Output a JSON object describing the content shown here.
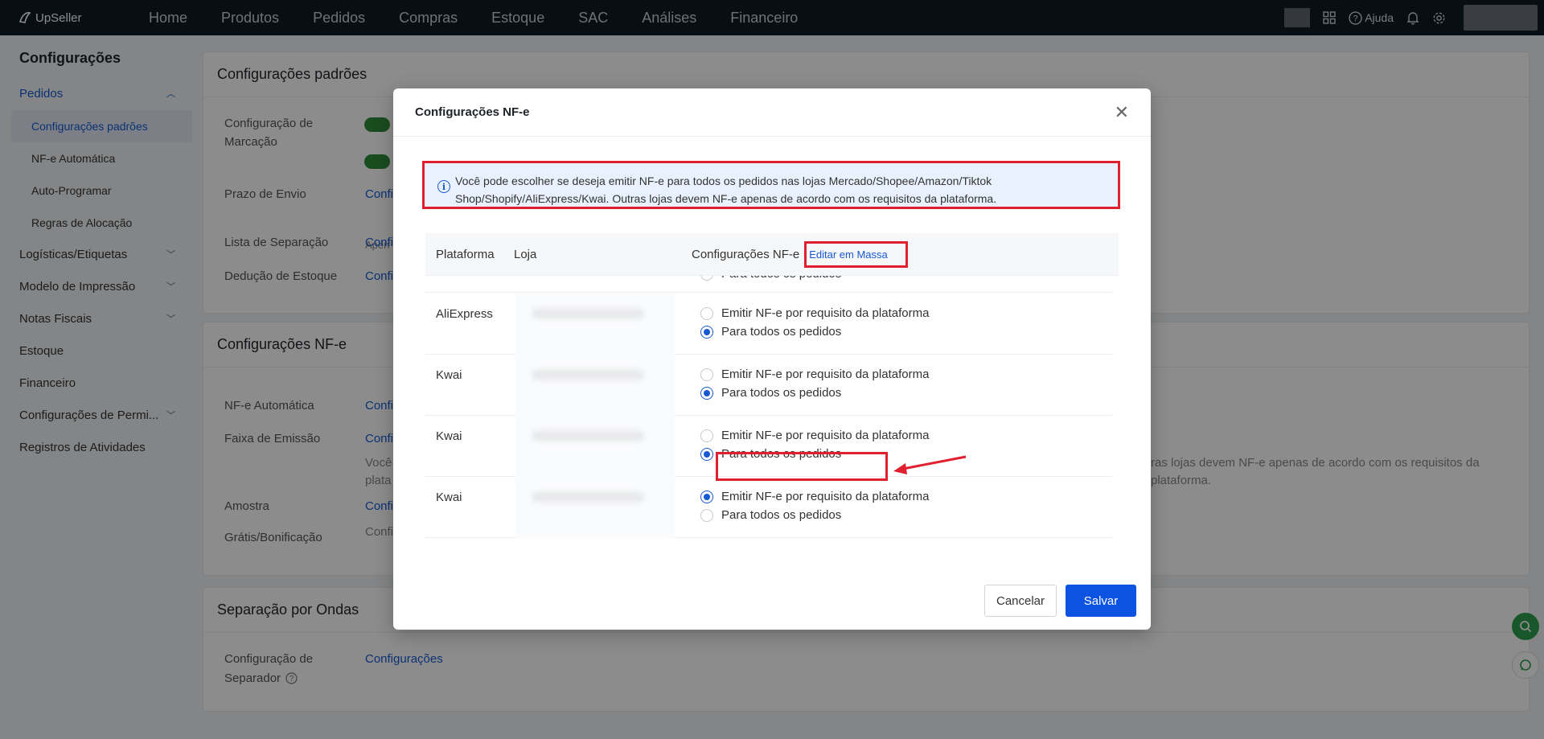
{
  "app": {
    "brand": "UpSeller"
  },
  "nav": [
    "Home",
    "Produtos",
    "Pedidos",
    "Compras",
    "Estoque",
    "SAC",
    "Análises",
    "Financeiro"
  ],
  "topbar": {
    "help_label": "Ajuda"
  },
  "sidebar": {
    "title": "Configurações",
    "group_pedidos": "Pedidos",
    "sub_items": [
      "Configurações padrões",
      "NF-e Automática",
      "Auto-Programar",
      "Regras de Alocação"
    ],
    "items": [
      "Logísticas/Etiquetas",
      "Modelo de Impressão",
      "Notas Fiscais",
      "Estoque",
      "Financeiro",
      "Configurações de Permi...",
      "Registros de Atividades"
    ]
  },
  "main": {
    "card1": {
      "title": "Configurações padrões",
      "labels": [
        "Configuração de",
        "Marcação",
        "Prazo de Envio",
        "Lista de Separação",
        "Dedução de Estoque"
      ],
      "links": [
        "Confi",
        "Confi",
        "Confi"
      ],
      "sub_text": "Apen"
    },
    "card2": {
      "title": "Configurações NF-e",
      "labels": [
        "NF-e Automática",
        "Faixa de Emissão",
        "Amostra",
        "Grátis/Bonificação"
      ],
      "links": [
        "Confi",
        "Confi",
        "Confi",
        "Confi"
      ],
      "text_left": "Você",
      "text_left2": "plata",
      "text_right": "ras lojas devem NF-e apenas de acordo com os requisitos da",
      "text_right2": "plataforma."
    },
    "card3": {
      "title": "Separação por Ondas",
      "label1": "Configuração de",
      "label2": "Separador",
      "link": "Configurações"
    }
  },
  "modal": {
    "title": "Configurações NF-e",
    "info": "Você pode escolher se deseja emitir NF-e para todos os pedidos nas lojas Mercado/Shopee/Amazon/Tiktok Shop/Shopify/AliExpress/Kwai. Outras lojas devem NF-e apenas de acordo com os requisitos da plataforma.",
    "columns": {
      "platform": "Plataforma",
      "store": "Loja",
      "config": "Configurações NF-e",
      "mass_edit": "Editar em Massa"
    },
    "option_platform": "Emitir NF-e por requisito da plataforma",
    "option_all": "Para todos os pedidos",
    "rows": [
      {
        "platform": "AliExpress",
        "selected": "all"
      },
      {
        "platform": "Kwai",
        "selected": "all"
      },
      {
        "platform": "Kwai",
        "selected": "all"
      },
      {
        "platform": "Kwai",
        "selected": "platform"
      }
    ],
    "cancel": "Cancelar",
    "save": "Salvar"
  },
  "colors": {
    "accent": "#1659d1",
    "primary_button": "#0b53e0",
    "annotation_red": "#e0202e",
    "topbar": "#0d1a26"
  }
}
